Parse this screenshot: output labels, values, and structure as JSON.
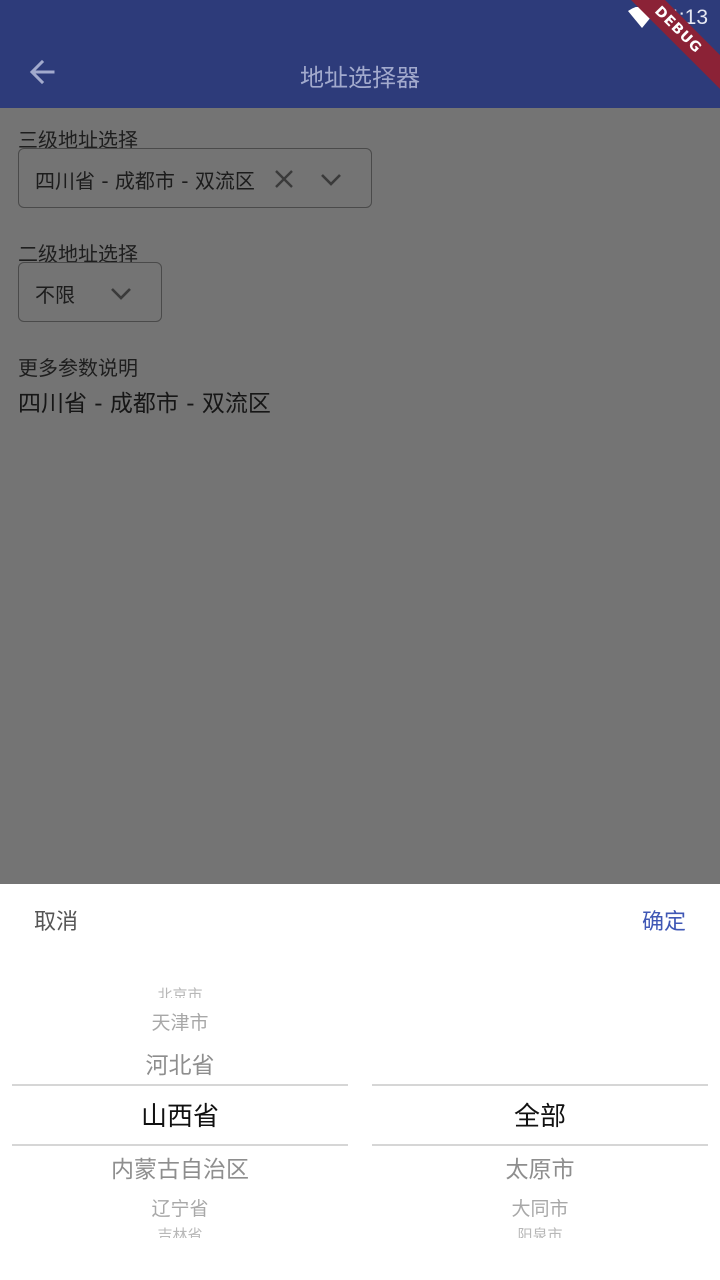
{
  "status_bar": {
    "time": "4:13",
    "wifi_icon": "wifi-icon"
  },
  "app_bar": {
    "title": "地址选择器",
    "back_icon": "arrow-back-icon",
    "debug_banner": "DEBUG"
  },
  "form": {
    "three_level": {
      "label": "三级地址选择",
      "value": "四川省 - 成都市 - 双流区",
      "clear_icon": "close-icon",
      "dropdown_icon": "chevron-down-icon"
    },
    "two_level": {
      "label": "二级地址选择",
      "value": "不限",
      "dropdown_icon": "chevron-down-icon"
    },
    "more": {
      "label": "更多参数说明",
      "value": "四川省 - 成都市 - 双流区"
    }
  },
  "picker": {
    "cancel_label": "取消",
    "confirm_label": "确定",
    "province_items": [
      "北京市",
      "天津市",
      "河北省",
      "山西省",
      "内蒙古自治区",
      "辽宁省",
      "吉林省"
    ],
    "province_selected": "山西省",
    "city_items": [
      "全部",
      "太原市",
      "大同市",
      "阳泉市"
    ],
    "city_selected": "全部"
  },
  "colors": {
    "app_bar": "#2d3b7a",
    "overlay": "#747474",
    "accent": "#3f57b5",
    "debug": "#8b2236"
  }
}
